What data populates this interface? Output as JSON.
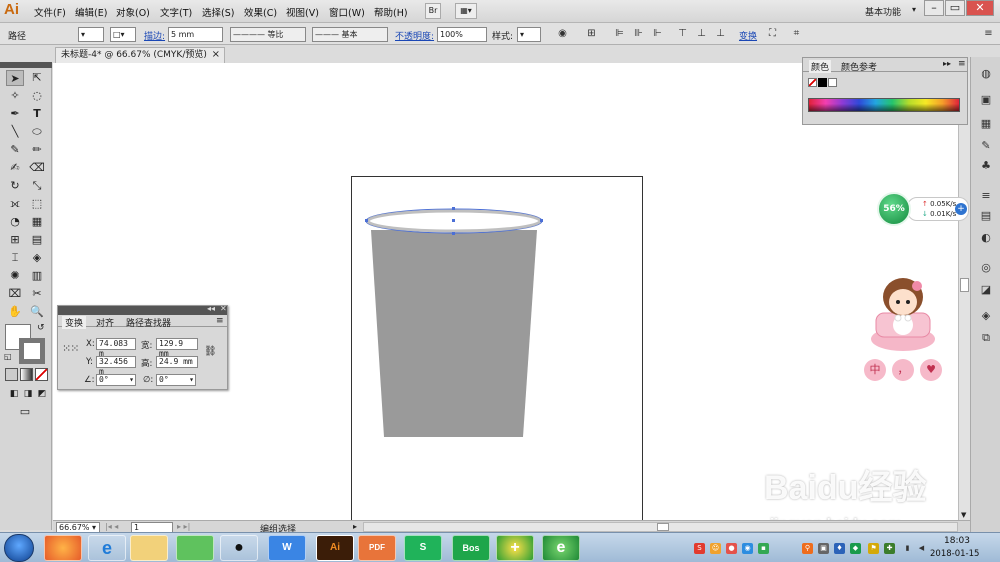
{
  "app": {
    "logo": "Ai",
    "menus": [
      "文件(F)",
      "编辑(E)",
      "对象(O)",
      "文字(T)",
      "选择(S)",
      "效果(C)",
      "视图(V)",
      "窗口(W)",
      "帮助(H)"
    ],
    "menu_btn1": "Br",
    "workspace": "基本功能",
    "win_min": "–",
    "win_max": "▭",
    "win_close": "✕"
  },
  "control": {
    "path_label": "路径",
    "stroke_label": "描边:",
    "stroke_value": "5 mm",
    "profile_label": "等比",
    "brush_label": "基本",
    "opacity_label": "不透明度:",
    "opacity_value": "100%",
    "style_label": "样式:",
    "transform_link": "变换"
  },
  "document": {
    "tab_title": "未标题-4* @ 66.67% (CMYK/预览)",
    "tab_close": "×"
  },
  "transform_panel": {
    "tabs": [
      "变换",
      "对齐",
      "路径查找器"
    ],
    "x_label": "X:",
    "x_value": "74.083 m",
    "w_label": "宽:",
    "w_value": "129.9 mm",
    "y_label": "Y:",
    "y_value": "32.456 m",
    "h_label": "高:",
    "h_value": "24.9 mm",
    "rot_value": "0°",
    "shear_value": "0°"
  },
  "color_panel": {
    "tabs": [
      "颜色",
      "颜色参考"
    ]
  },
  "network": {
    "percent": "56%",
    "up": "0.05K/s",
    "down": "0.01K/s"
  },
  "sticker": {
    "labels": [
      "中",
      "，",
      "♥"
    ]
  },
  "status": {
    "zoom": "66.67%",
    "page": "1",
    "mode": "编组选择"
  },
  "watermark": {
    "logo": "Baidu经验",
    "url": "jingyan.baidu.com"
  },
  "taskbar": {
    "apps": [
      "e",
      "",
      "",
      "",
      "W",
      "Ai",
      "PDF",
      "S",
      "Bos",
      "+",
      "e"
    ],
    "time": "18:03",
    "date": "2018-01-15"
  },
  "colors": {
    "cup_fill": "#9a9a9a",
    "selection": "#4b6fd6"
  }
}
